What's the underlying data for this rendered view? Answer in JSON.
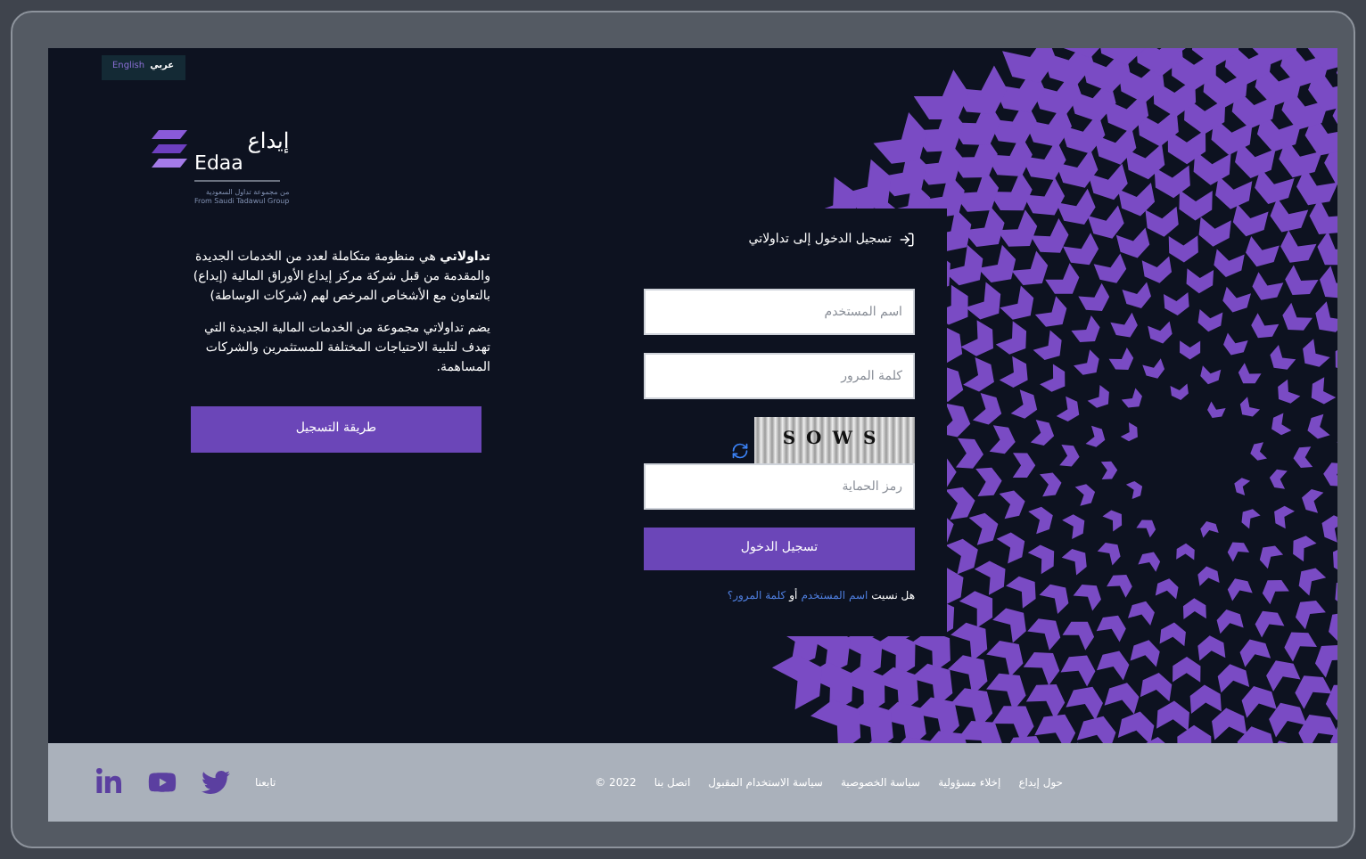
{
  "language_toggle": [
    {
      "label": "عربي",
      "selected": true
    },
    {
      "label": "English",
      "selected": false
    }
  ],
  "logo": {
    "name_ar": "إيداع",
    "name_en": "Edaa",
    "tagline_ar": "من مجموعة تداول السعودية",
    "tagline_en": "From Saudi Tadawul Group"
  },
  "intro": [
    "**تداولاتي** هي منظومة متكاملة لعدد من الخدمات الجديدة والمقدمة من قبل شركة مركز إيداع الأوراق المالية (إيداع) بالتعاون مع الأشخاص المرخص لهم (شركات الوساطة)",
    "يضم تداولاتي مجموعة من الخدمات المالية الجديدة التي تهدف لتلبية الاحتياجات المختلفة للمستثمرين والشركات المساهمة."
  ],
  "register_button": "طريقة التسجيل",
  "login": {
    "title": "تسجيل الدخول إلى تداولاتي",
    "username": {
      "placeholder": "اسم المستخدم"
    },
    "password": {
      "placeholder": "كلمة المرور"
    },
    "captcha": "SOWS",
    "captcha_code": {
      "placeholder": "رمز الحماية"
    },
    "submit": "تسجيل الدخول",
    "forgot_prefix": "هل نسيت",
    "forgot_username": "اسم المستخدم",
    "forgot_or": "أو",
    "forgot_password": "كلمة المرور؟"
  },
  "footer": {
    "links": [
      "حول إيداع",
      "إخلاء مسؤولية",
      "سياسة الخصوصية",
      "سياسة الاستخدام المقبول",
      "اتصل بنا"
    ],
    "copyright": "© 2022",
    "follow": "تابعنا",
    "social": [
      {
        "kind": "twitter"
      },
      {
        "kind": "youtube"
      },
      {
        "kind": "linkedin"
      }
    ]
  }
}
